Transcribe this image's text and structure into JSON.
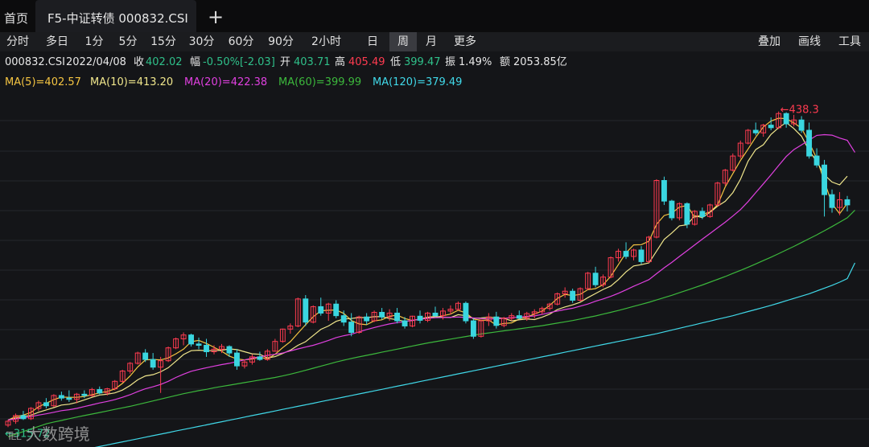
{
  "tabs": {
    "home": "首页",
    "active": "F5-中证转债 000832.CSI",
    "add": "+"
  },
  "periods": [
    "分时",
    "多日",
    "1分",
    "5分",
    "15分",
    "30分",
    "60分",
    "90分",
    "2小时",
    "日",
    "周",
    "月",
    "更多"
  ],
  "selected_period": "周",
  "tools": [
    "叠加",
    "画线",
    "工具"
  ],
  "info": {
    "code": "000832.CSI",
    "date": "2022/04/08",
    "close_label": "收",
    "close": "402.02",
    "range_label": "幅",
    "change": "-0.50%[-2.03]",
    "open_label": "开",
    "open": "403.71",
    "high_label": "高",
    "high": "405.49",
    "low_label": "低",
    "low": "399.47",
    "amp_label": "振",
    "amplitude": "1.49%",
    "amount_label": "额",
    "amount": "2053.85亿"
  },
  "ma": [
    {
      "text": "MA(5)=402.57",
      "color": "#f5c542"
    },
    {
      "text": "MA(10)=413.20",
      "color": "#f0e68c"
    },
    {
      "text": "MA(20)=422.38",
      "color": "#e040e0"
    },
    {
      "text": "MA(60)=399.99",
      "color": "#3cb83c"
    },
    {
      "text": "MA(120)=379.49",
      "color": "#40d8e8"
    }
  ],
  "watermark": "大数跨境",
  "chart_data": {
    "type": "candlestick",
    "ylim": [
      308,
      446
    ],
    "max_label": "438.3",
    "min_label": "315.72",
    "up_color": "#ff3b50",
    "down_color": "#3ad6e0",
    "candles": [
      [
        316.5,
        318.5,
        315.72,
        318.0
      ],
      [
        318.0,
        321.0,
        317.0,
        320.2
      ],
      [
        320.2,
        322.0,
        318.5,
        319.0
      ],
      [
        319.0,
        323.5,
        318.5,
        323.0
      ],
      [
        323.0,
        326.0,
        322.0,
        325.2
      ],
      [
        325.2,
        327.0,
        323.0,
        324.0
      ],
      [
        324.0,
        328.5,
        323.5,
        328.0
      ],
      [
        328.0,
        329.5,
        326.0,
        327.0
      ],
      [
        327.0,
        330.0,
        325.5,
        326.5
      ],
      [
        326.5,
        329.0,
        325.0,
        328.5
      ],
      [
        328.5,
        330.0,
        327.0,
        328.0
      ],
      [
        328.0,
        331.0,
        327.5,
        330.3
      ],
      [
        330.3,
        331.5,
        328.5,
        329.0
      ],
      [
        329.0,
        331.0,
        328.0,
        330.6
      ],
      [
        330.6,
        334.0,
        330.0,
        333.5
      ],
      [
        333.5,
        338.0,
        333.0,
        337.5
      ],
      [
        337.5,
        341.0,
        336.5,
        340.5
      ],
      [
        340.5,
        345.0,
        340.0,
        344.5
      ],
      [
        344.5,
        346.0,
        341.0,
        342.0
      ],
      [
        342.0,
        344.5,
        338.0,
        339.0
      ],
      [
        339.0,
        343.0,
        329.0,
        341.5
      ],
      [
        341.5,
        347.0,
        341.0,
        346.5
      ],
      [
        346.5,
        350.5,
        346.0,
        350.0
      ],
      [
        350.0,
        352.5,
        347.5,
        351.5
      ],
      [
        351.5,
        352.0,
        347.0,
        348.0
      ],
      [
        348.0,
        350.5,
        346.0,
        347.5
      ],
      [
        347.5,
        350.0,
        343.0,
        345.0
      ],
      [
        345.0,
        347.5,
        344.0,
        346.0
      ],
      [
        346.0,
        348.0,
        344.5,
        347.0
      ],
      [
        347.0,
        347.5,
        343.0,
        344.5
      ],
      [
        344.5,
        346.0,
        338.0,
        339.5
      ],
      [
        339.5,
        342.0,
        338.5,
        341.0
      ],
      [
        341.0,
        344.0,
        340.0,
        343.0
      ],
      [
        343.0,
        345.0,
        341.5,
        342.0
      ],
      [
        342.0,
        346.0,
        341.5,
        345.2
      ],
      [
        345.2,
        350.0,
        345.0,
        349.0
      ],
      [
        349.0,
        354.0,
        348.5,
        353.8
      ],
      [
        353.8,
        356.0,
        352.0,
        355.0
      ],
      [
        355.0,
        366.0,
        354.5,
        365.5
      ],
      [
        365.5,
        367.0,
        355.0,
        356.5
      ],
      [
        356.5,
        363.0,
        356.0,
        362.5
      ],
      [
        362.5,
        366.0,
        359.0,
        360.0
      ],
      [
        360.0,
        364.0,
        357.0,
        363.5
      ],
      [
        363.5,
        365.0,
        358.0,
        359.0
      ],
      [
        359.0,
        361.0,
        355.0,
        356.5
      ],
      [
        356.5,
        360.0,
        351.0,
        352.5
      ],
      [
        352.5,
        359.0,
        352.0,
        358.5
      ],
      [
        358.5,
        360.0,
        355.5,
        357.0
      ],
      [
        357.0,
        361.0,
        356.5,
        360.3
      ],
      [
        360.3,
        362.0,
        357.5,
        358.5
      ],
      [
        358.5,
        361.5,
        357.0,
        360.0
      ],
      [
        360.0,
        362.0,
        356.0,
        357.0
      ],
      [
        357.0,
        358.5,
        354.0,
        355.0
      ],
      [
        355.0,
        359.0,
        354.5,
        358.8
      ],
      [
        358.8,
        361.0,
        356.0,
        357.2
      ],
      [
        357.2,
        360.5,
        356.5,
        360.0
      ],
      [
        360.0,
        362.5,
        358.5,
        359.0
      ],
      [
        359.0,
        362.0,
        357.5,
        360.8
      ],
      [
        360.8,
        363.0,
        359.5,
        361.5
      ],
      [
        361.5,
        364.5,
        361.0,
        363.8
      ],
      [
        363.8,
        364.5,
        356.0,
        357.0
      ],
      [
        357.0,
        358.0,
        350.0,
        351.0
      ],
      [
        351.0,
        357.5,
        350.5,
        357.0
      ],
      [
        357.0,
        360.0,
        355.0,
        358.5
      ],
      [
        358.5,
        360.5,
        354.0,
        355.2
      ],
      [
        355.2,
        358.5,
        354.5,
        358.0
      ],
      [
        358.0,
        360.0,
        357.0,
        359.0
      ],
      [
        359.0,
        361.0,
        357.5,
        358.0
      ],
      [
        358.0,
        360.5,
        357.0,
        359.8
      ],
      [
        359.8,
        361.5,
        358.0,
        360.5
      ],
      [
        360.5,
        362.5,
        359.5,
        361.8
      ],
      [
        361.8,
        364.0,
        361.0,
        363.5
      ],
      [
        363.5,
        368.0,
        363.0,
        367.5
      ],
      [
        367.5,
        370.0,
        366.0,
        368.5
      ],
      [
        368.5,
        369.5,
        364.0,
        365.0
      ],
      [
        365.0,
        370.0,
        364.5,
        369.5
      ],
      [
        369.5,
        376.0,
        369.0,
        375.5
      ],
      [
        375.5,
        378.0,
        370.0,
        371.0
      ],
      [
        371.0,
        375.0,
        370.0,
        374.0
      ],
      [
        374.0,
        382.0,
        373.5,
        381.5
      ],
      [
        381.5,
        385.0,
        380.0,
        384.0
      ],
      [
        384.0,
        387.5,
        381.0,
        382.0
      ],
      [
        382.0,
        385.0,
        380.5,
        384.5
      ],
      [
        384.5,
        386.0,
        379.0,
        380.0
      ],
      [
        380.0,
        390.0,
        379.5,
        389.5
      ],
      [
        389.5,
        412.0,
        389.0,
        411.5
      ],
      [
        411.5,
        413.0,
        402.0,
        403.5
      ],
      [
        403.5,
        404.0,
        396.0,
        397.0
      ],
      [
        397.0,
        403.0,
        396.0,
        402.5
      ],
      [
        402.5,
        403.0,
        393.0,
        394.5
      ],
      [
        394.5,
        400.0,
        394.0,
        399.5
      ],
      [
        399.5,
        401.0,
        396.5,
        397.5
      ],
      [
        397.5,
        402.5,
        397.0,
        402.0
      ],
      [
        402.0,
        411.0,
        401.5,
        410.5
      ],
      [
        410.5,
        416.0,
        409.5,
        415.5
      ],
      [
        415.5,
        422.0,
        415.0,
        421.0
      ],
      [
        421.0,
        427.0,
        420.0,
        426.0
      ],
      [
        426.0,
        431.5,
        425.5,
        431.0
      ],
      [
        431.0,
        434.0,
        429.0,
        430.0
      ],
      [
        430.0,
        433.5,
        428.5,
        433.0
      ],
      [
        433.0,
        436.0,
        431.0,
        432.0
      ],
      [
        432.0,
        438.3,
        431.5,
        437.5
      ],
      [
        437.5,
        438.0,
        432.0,
        433.5
      ],
      [
        433.5,
        437.0,
        432.5,
        435.0
      ],
      [
        435.0,
        436.5,
        430.0,
        431.0
      ],
      [
        431.0,
        434.0,
        420.0,
        421.0
      ],
      [
        421.0,
        424.0,
        416.5,
        417.5
      ],
      [
        417.5,
        419.5,
        397.5,
        406.0
      ],
      [
        406.0,
        408.0,
        399.0,
        401.0
      ],
      [
        401.0,
        407.0,
        398.0,
        404.03
      ],
      [
        404.03,
        405.49,
        399.47,
        402.02
      ]
    ],
    "ma_lines": [
      {
        "name": "MA(5)",
        "color": "#f5c542",
        "values": [
          318.5,
          319.8,
          320.4,
          321.4,
          323.6,
          325.0,
          326.4,
          327.4,
          327.3,
          327.3,
          327.6,
          328.3,
          329.0,
          329.6,
          330.5,
          332.7,
          335.6,
          339.1,
          341.8,
          342.0,
          341.8,
          342.6,
          344.2,
          346.0,
          348.9,
          349.4,
          348.2,
          346.7,
          345.2,
          343.3,
          342.2,
          341.8,
          342.2,
          342.9,
          342.2,
          344.0,
          346.6,
          348.9,
          352.2,
          355.5,
          358.6,
          360.9,
          361.1,
          361.2,
          359.9,
          357.1,
          355.8,
          355.5,
          357.0,
          357.4,
          358.8,
          359.2,
          357.9,
          357.1,
          357.7,
          358.0,
          358.3,
          359.0,
          359.6,
          361.1,
          360.1,
          357.7,
          357.2,
          357.3,
          355.4,
          356.0,
          356.2,
          357.7,
          358.5,
          359.6,
          360.8,
          363.0,
          365.7,
          367.3,
          366.8,
          367.3,
          369.1,
          369.5,
          371.0,
          374.3,
          378.8,
          383.4,
          386.5,
          386.6,
          387.9,
          394.5,
          397.9,
          398.8,
          401.2,
          401.8,
          397.2,
          398.3,
          399.3,
          402.0,
          409.0,
          414.2,
          419.3,
          423.7,
          428.3,
          432.3,
          434.6,
          435.7,
          435.5,
          433.9,
          431.8,
          426.3,
          420.0,
          411.1,
          402.5,
          398.6,
          402.6
        ]
      },
      {
        "name": "MA(10)",
        "color": "#f0e68c",
        "values": [
          318.5,
          319.2,
          319.8,
          320.3,
          321.5,
          322.4,
          323.3,
          324.3,
          324.6,
          325.3,
          326.3,
          327.3,
          328.2,
          328.5,
          329.0,
          330.1,
          331.9,
          334.1,
          335.6,
          336.1,
          337.2,
          338.8,
          341.3,
          343.9,
          345.4,
          345.6,
          345.4,
          345.4,
          345.6,
          346.1,
          345.8,
          345.0,
          344.2,
          344.0,
          342.6,
          343.1,
          344.3,
          345.6,
          347.5,
          348.9,
          351.3,
          353.7,
          355.0,
          356.8,
          357.7,
          357.9,
          358.3,
          358.2,
          358.6,
          358.6,
          357.9,
          357.4,
          356.8,
          357.1,
          357.7,
          358.4,
          358.7,
          358.4,
          358.3,
          359.4,
          359.0,
          358.0,
          358.1,
          358.4,
          358.2,
          358.0,
          357.0,
          357.4,
          357.7,
          357.5,
          358.4,
          359.6,
          361.4,
          362.4,
          363.2,
          364.2,
          366.0,
          367.6,
          369.2,
          370.5,
          373.0,
          376.0,
          378.3,
          378.8,
          379.5,
          384.1,
          388.6,
          391.1,
          393.9,
          394.3,
          397.8,
          397.1,
          399.1,
          401.5,
          403.4,
          406.8,
          412.0,
          419.0,
          423.5,
          425.4,
          429.4,
          432.0,
          434.0,
          431.7,
          428.7,
          423.1,
          418.8,
          413.7,
          410.9,
          409.8,
          413.2
        ]
      },
      {
        "name": "MA(20)",
        "color": "#e040e0",
        "values": [
          318.5,
          318.9,
          319.3,
          319.8,
          320.4,
          320.9,
          321.5,
          322.1,
          322.5,
          323.0,
          323.7,
          324.4,
          325.1,
          325.7,
          326.4,
          327.3,
          328.3,
          329.5,
          330.6,
          331.4,
          332.3,
          333.5,
          335.0,
          336.3,
          337.4,
          338.1,
          338.8,
          339.4,
          340.0,
          340.5,
          341.2,
          341.8,
          342.5,
          343.0,
          343.6,
          344.0,
          344.5,
          345.3,
          346.1,
          346.8,
          347.5,
          348.4,
          349.4,
          350.5,
          351.2,
          351.8,
          352.7,
          353.6,
          354.4,
          355.1,
          355.8,
          356.3,
          356.7,
          357.2,
          357.6,
          358.0,
          358.2,
          358.3,
          358.4,
          358.5,
          358.3,
          358.1,
          357.9,
          357.7,
          357.8,
          358.0,
          358.2,
          358.5,
          358.7,
          358.9,
          359.5,
          360.2,
          360.8,
          361.4,
          361.9,
          362.7,
          363.5,
          364.6,
          365.5,
          366.5,
          367.7,
          369.0,
          370.4,
          371.7,
          373.0,
          375.3,
          377.6,
          379.7,
          382.0,
          384.2,
          386.5,
          388.7,
          390.9,
          393.1,
          395.3,
          397.7,
          400.2,
          403.3,
          406.8,
          410.2,
          413.7,
          417.3,
          420.8,
          423.5,
          425.3,
          427.2,
          429.0,
          429.3,
          429.1,
          428.0,
          427.1,
          422.4
        ]
      },
      {
        "name": "MA(60)",
        "color": "#3cb83c",
        "values": [
          312.0,
          313.0,
          314.0,
          315.0,
          316.0,
          317.0,
          317.7,
          318.3,
          319.0,
          319.6,
          320.2,
          320.8,
          321.4,
          322.0,
          322.6,
          323.2,
          323.8,
          324.5,
          325.2,
          325.9,
          326.6,
          327.3,
          328.0,
          328.7,
          329.3,
          329.9,
          330.4,
          331.0,
          331.5,
          332.0,
          332.5,
          333.0,
          333.5,
          334.0,
          334.5,
          335.0,
          335.6,
          336.3,
          337.0,
          337.8,
          338.6,
          339.4,
          340.2,
          341.0,
          341.7,
          342.4,
          343.0,
          343.6,
          344.2,
          344.8,
          345.4,
          346.0,
          346.6,
          347.2,
          347.8,
          348.4,
          348.9,
          349.4,
          349.9,
          350.4,
          350.9,
          351.4,
          351.9,
          352.3,
          352.7,
          353.1,
          353.5,
          353.9,
          354.3,
          354.7,
          355.1,
          355.6,
          356.1,
          356.6,
          357.1,
          357.7,
          358.3,
          358.9,
          359.6,
          360.3,
          361.0,
          361.8,
          362.6,
          363.4,
          364.2,
          365.1,
          366.0,
          366.9,
          367.9,
          368.9,
          369.9,
          370.9,
          372.0,
          373.1,
          374.2,
          375.4,
          376.6,
          377.8,
          379.1,
          380.4,
          381.7,
          383.1,
          384.5,
          385.9,
          387.4,
          388.9,
          390.4,
          392.0,
          393.6,
          395.3,
          397.0,
          399.99
        ]
      },
      {
        "name": "MA(120)",
        "color": "#40d8e8",
        "values": [
          301.0,
          301.6,
          302.2,
          302.8,
          303.4,
          304.0,
          304.6,
          305.2,
          305.8,
          306.4,
          307.0,
          307.6,
          308.2,
          308.8,
          309.4,
          310.0,
          310.6,
          311.2,
          311.8,
          312.4,
          313.0,
          313.6,
          314.2,
          314.8,
          315.4,
          316.0,
          316.6,
          317.2,
          317.8,
          318.4,
          319.0,
          319.6,
          320.2,
          320.8,
          321.4,
          322.0,
          322.6,
          323.2,
          323.8,
          324.4,
          325.0,
          325.6,
          326.2,
          326.8,
          327.4,
          328.0,
          328.6,
          329.2,
          329.8,
          330.4,
          331.0,
          331.6,
          332.2,
          332.8,
          333.4,
          334.0,
          334.6,
          335.2,
          335.8,
          336.4,
          337.0,
          337.6,
          338.2,
          338.8,
          339.4,
          340.0,
          340.6,
          341.2,
          341.8,
          342.4,
          343.0,
          343.6,
          344.2,
          344.8,
          345.4,
          346.0,
          346.6,
          347.2,
          347.8,
          348.4,
          349.0,
          349.6,
          350.2,
          350.8,
          351.4,
          352.0,
          352.7,
          353.4,
          354.1,
          354.8,
          355.5,
          356.2,
          356.9,
          357.6,
          358.3,
          359.0,
          359.8,
          360.6,
          361.4,
          362.2,
          363.0,
          363.9,
          364.8,
          365.7,
          366.6,
          367.5,
          368.6,
          369.7,
          370.8,
          372.0,
          373.4,
          379.49
        ]
      }
    ]
  }
}
